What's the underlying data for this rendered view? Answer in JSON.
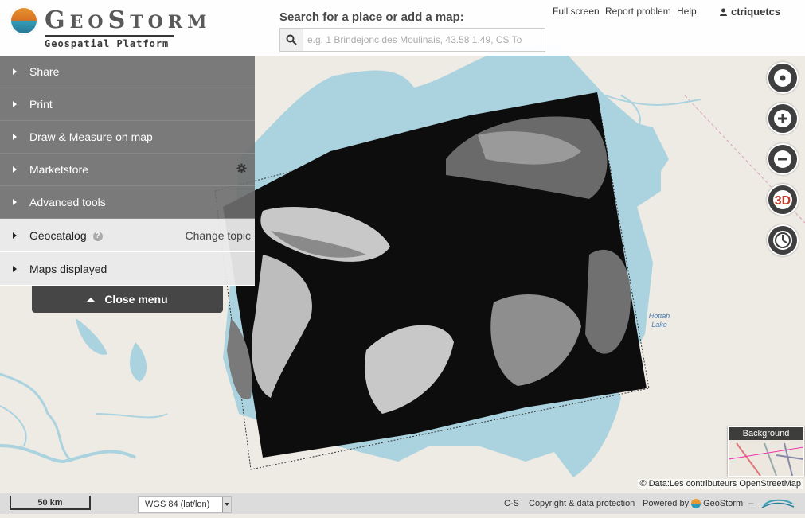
{
  "header": {
    "logo_name": "GeoStorm",
    "logo_subtitle": "Geospatial Platform",
    "search_label": "Search for a place or add a map:",
    "search_placeholder": "e.g. 1 Brindejonc des Moulinais, 43.58 1.49, CS To",
    "links": {
      "fullscreen": "Full screen",
      "report": "Report problem",
      "help": "Help"
    },
    "user": "ctriquetcs"
  },
  "menu": {
    "items": [
      {
        "label": "Share"
      },
      {
        "label": "Print"
      },
      {
        "label": "Draw & Measure on map"
      },
      {
        "label": "Marketstore"
      },
      {
        "label": "Advanced tools"
      }
    ],
    "geocatalog": {
      "label": "Géocatalog",
      "change_topic": "Change topic"
    },
    "maps_displayed": "Maps displayed",
    "close": "Close menu"
  },
  "map": {
    "lake_label": "Hottah Lake",
    "button_3d": "3D",
    "background_label": "Background",
    "attribution": "© Data:Les contributeurs OpenStreetMap"
  },
  "footer": {
    "scale": "50 km",
    "projection": "WGS 84 (lat/lon)",
    "cs": "C-S",
    "copyright": "Copyright & data protection",
    "powered_by": "Powered by",
    "powered_name": "GeoStorm",
    "dash": "–"
  },
  "colors": {
    "water": "#aad3df",
    "land": "#eeeae4",
    "menu_dark": "#6e6e6e",
    "button_dark": "#3f3f3f",
    "accent_3d": "#c0392b"
  },
  "icons": [
    "search-icon",
    "user-icon",
    "caret-right-icon",
    "gear-icon",
    "help-icon",
    "caret-up-icon",
    "locate-icon",
    "zoom-in-icon",
    "zoom-out-icon",
    "3d-icon",
    "history-icon"
  ]
}
